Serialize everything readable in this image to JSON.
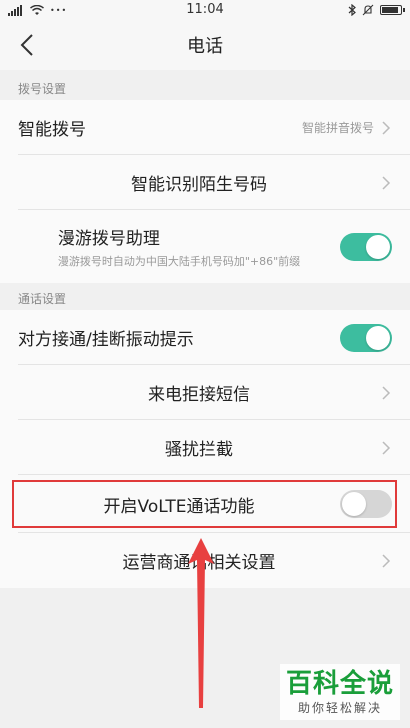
{
  "status_bar": {
    "time": "11:04",
    "signal_label": "ಒ",
    "dots": "•••"
  },
  "header": {
    "title": "电话"
  },
  "sections": [
    {
      "title": "拨号设置"
    },
    {
      "title": "通话设置"
    }
  ],
  "rows": {
    "smart_dial": {
      "label": "智能拨号",
      "value": "智能拼音拨号"
    },
    "identify_stranger": {
      "label": "智能识别陌生号码"
    },
    "roaming_assistant": {
      "label": "漫游拨号助理",
      "sub": "漫游拨号时自动为中国大陆手机号码加\"+86\"前缀",
      "toggle": "on"
    },
    "vibrate_hint": {
      "label": "对方接通/挂断振动提示",
      "toggle": "on"
    },
    "reject_sms": {
      "label": "来电拒接短信"
    },
    "block": {
      "label": "骚扰拦截"
    },
    "volte": {
      "label": "开启VoLTE通话功能",
      "toggle": "off"
    },
    "carrier": {
      "label": "运营商通话相关设置"
    }
  },
  "colors": {
    "toggle_on": "#3dbd9f",
    "toggle_off": "#d6d6d6",
    "highlight": "#e03a3a"
  },
  "watermark": {
    "title": "百科全说",
    "subtitle": "助你轻松解决"
  }
}
